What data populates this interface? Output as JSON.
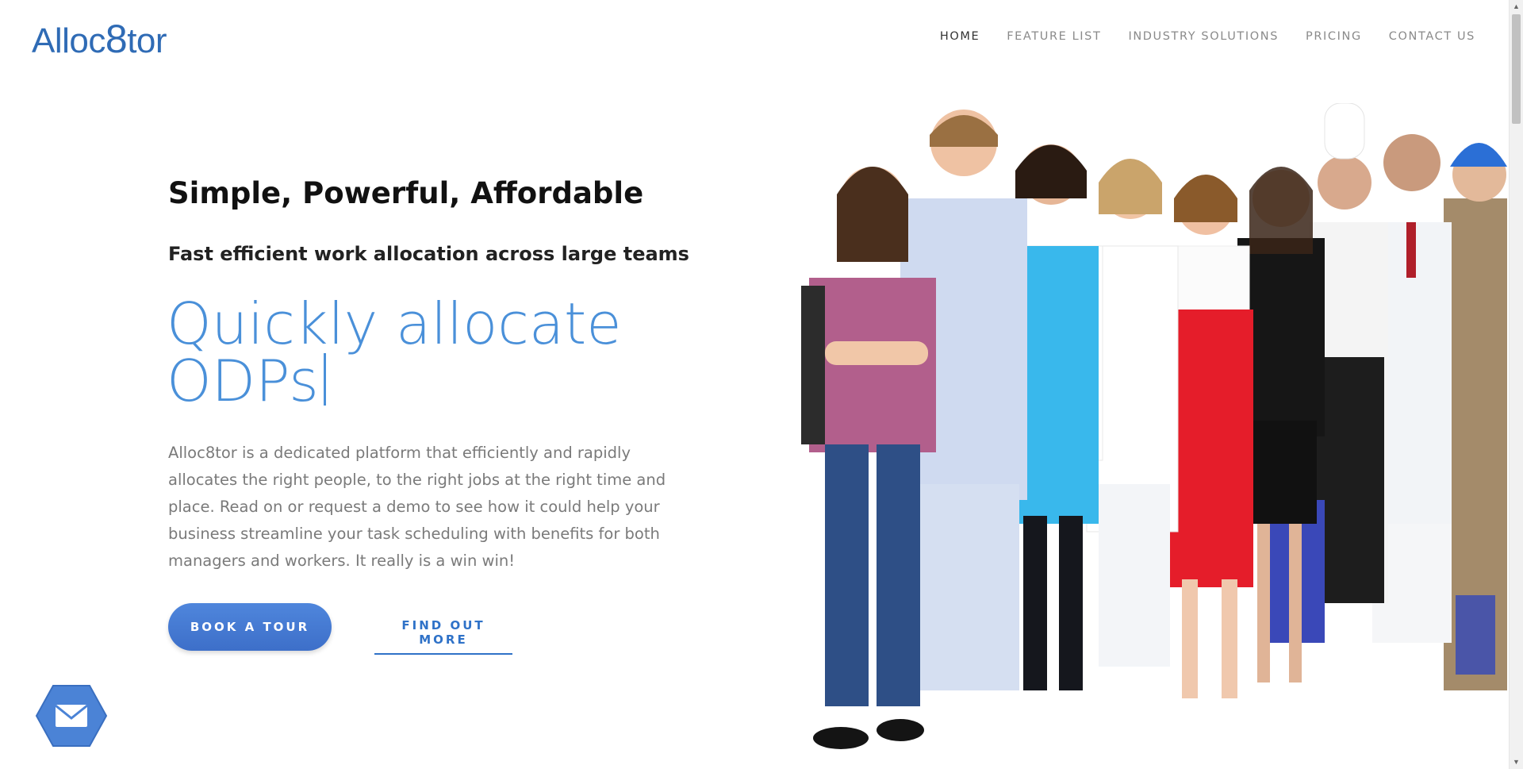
{
  "brand": {
    "logo_prefix": "Alloc",
    "logo_eight": "8",
    "logo_suffix": "tor",
    "color": "#2f6bb5"
  },
  "nav": {
    "items": [
      {
        "label": "HOME",
        "active": true
      },
      {
        "label": "FEATURE LIST",
        "active": false
      },
      {
        "label": "INDUSTRY SOLUTIONS",
        "active": false
      },
      {
        "label": "PRICING",
        "active": false
      },
      {
        "label": "CONTACT US",
        "active": false
      }
    ]
  },
  "hero": {
    "title": "Simple, Powerful, Affordable",
    "subtitle": "Fast efficient work allocation across large teams",
    "typed_line1": "Quickly allocate",
    "typed_line2": "ODPs",
    "description": "Alloc8tor is a dedicated platform that efficiently and rapidly allocates the right people, to the right jobs at the right time and place. Read on or request a demo to see how it could help your business streamline your task scheduling with benefits for both managers and workers. It really is a win win!",
    "accent_color": "#4a90d9"
  },
  "buttons": {
    "book_tour": "BOOK A TOUR",
    "find_out_more": "FIND OUT MORE"
  },
  "icons": {
    "mail": "mail-icon",
    "scroll_up": "chevron-up-icon",
    "scroll_down": "chevron-down-icon"
  },
  "image": {
    "people_count": 9
  }
}
